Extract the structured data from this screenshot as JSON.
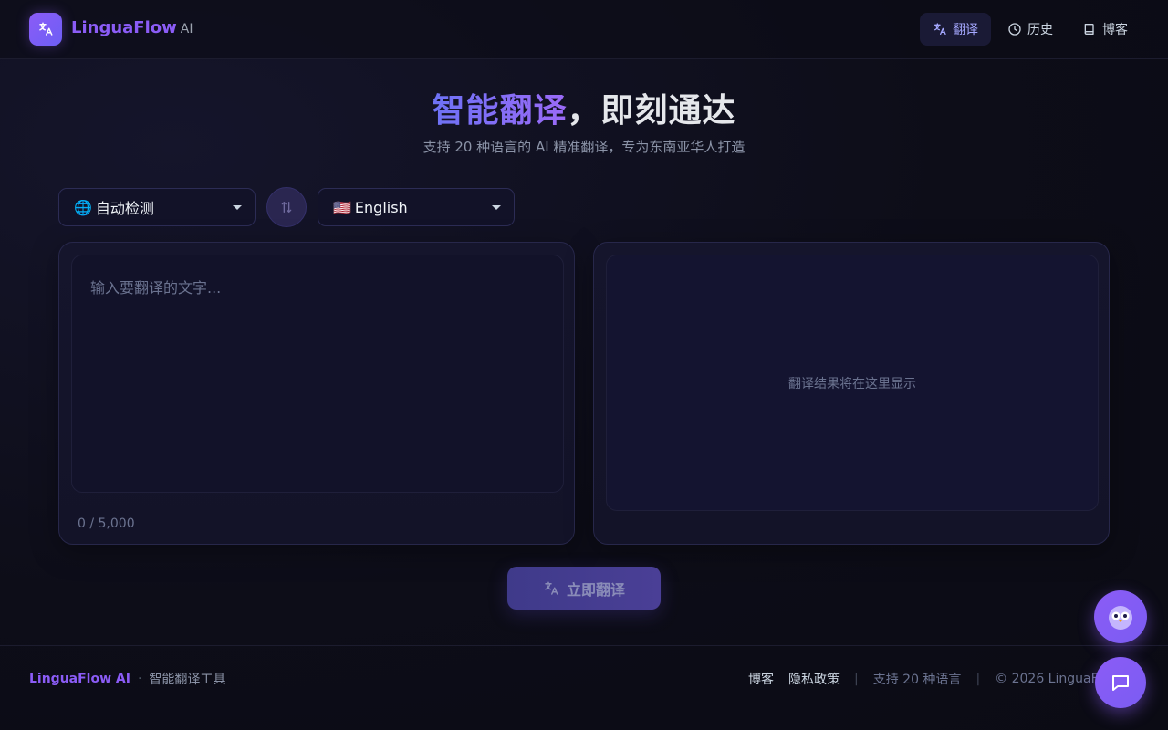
{
  "header": {
    "brand_name": "LinguaFlow",
    "brand_suffix": "AI",
    "nav": [
      {
        "label": "翻译",
        "icon": "translate-icon",
        "active": true
      },
      {
        "label": "历史",
        "icon": "clock-icon",
        "active": false
      },
      {
        "label": "博客",
        "icon": "book-icon",
        "active": false
      }
    ]
  },
  "hero": {
    "title_highlight": "智能翻译",
    "title_rest": "，即刻通达",
    "subtitle": "支持 20 种语言的 AI 精准翻译，专为东南亚华人打造"
  },
  "languages": {
    "source": {
      "flag": "🌐",
      "label": "自动检测"
    },
    "target": {
      "flag": "🇺🇸",
      "label": "English"
    }
  },
  "input": {
    "placeholder": "输入要翻译的文字...",
    "value": "",
    "char_count": "0 / 5,000"
  },
  "output": {
    "placeholder": "翻译结果将在这里显示"
  },
  "actions": {
    "translate_label": "立即翻译"
  },
  "footer": {
    "brand": "LinguaFlow AI",
    "dot": "·",
    "tagline": "智能翻译工具",
    "links": [
      "博客",
      "隐私政策"
    ],
    "sep": "|",
    "languages_note": "支持 20 种语言",
    "copyright": "© 2026 LinguaFlow AI"
  },
  "colors": {
    "accent": "#8b5cf6",
    "background": "#0d0d18",
    "panel": "#131328"
  }
}
